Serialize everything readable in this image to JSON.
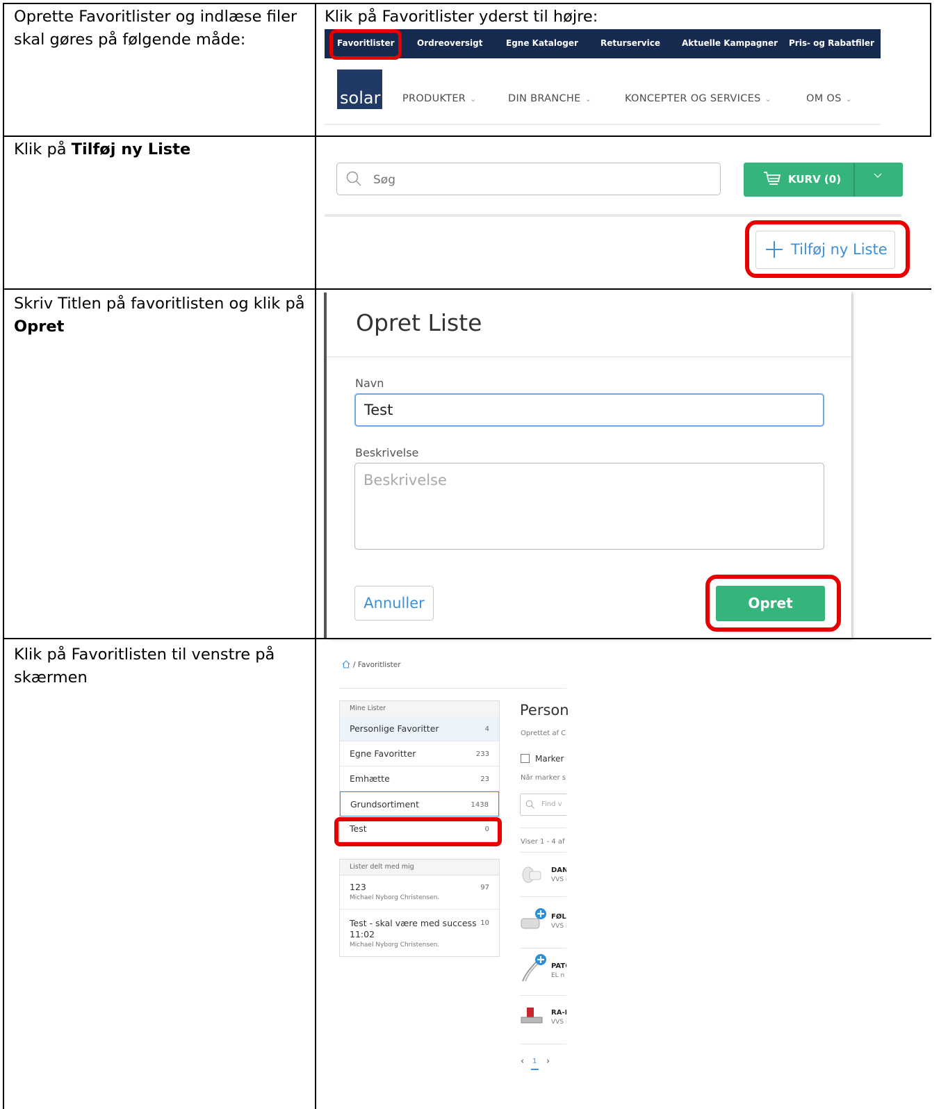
{
  "rows": [
    {
      "left_text": "Oprette Favoritlister og indlæse filer skal gøres på følgende måde:",
      "right_title": "Klik på Favoritlister yderst til højre:"
    },
    {
      "left_prefix": "Klik på ",
      "left_bold": "Tilføj ny Liste"
    },
    {
      "left_prefix": "Skriv Titlen på favoritlisten og klik på ",
      "left_bold": "Opret"
    },
    {
      "left_text": "Klik på Favoritlisten til venstre på skærmen"
    }
  ],
  "nav": {
    "items": [
      "Favoritlister",
      "Ordreoversigt",
      "Egne Kataloger",
      "Returservice",
      "Aktuelle Kampagner",
      "Pris- og Rabatfiler"
    ],
    "logo": "solar",
    "menu": [
      "PRODUKTER",
      "DIN BRANCHE",
      "KONCEPTER OG SERVICES",
      "OM OS"
    ]
  },
  "shop": {
    "search_placeholder": "Søg",
    "cart_label": "KURV (0)",
    "add_list_label": "Tilføj ny Liste"
  },
  "modal": {
    "title": "Opret Liste",
    "name_label": "Navn",
    "name_value": "Test",
    "desc_label": "Beskrivelse",
    "desc_placeholder": "Beskrivelse",
    "cancel": "Annuller",
    "create": "Opret"
  },
  "favorites": {
    "breadcrumb": "/ Favoritlister",
    "my_lists_header": "Mine Lister",
    "my_lists": [
      {
        "name": "Personlige Favoritter",
        "count": "4"
      },
      {
        "name": "Egne Favoritter",
        "count": "233"
      },
      {
        "name": "Emhætte",
        "count": "23"
      },
      {
        "name": "Grundsortiment",
        "count": "1438"
      },
      {
        "name": "Test",
        "count": "0"
      }
    ],
    "shared_header": "Lister delt med mig",
    "shared": [
      {
        "name": "123",
        "count": "97",
        "owner": "Michael Nyborg Christensen."
      },
      {
        "name": "Test - skal være med success",
        "name2": "11:02",
        "count": "10",
        "owner": "Michael Nyborg Christensen."
      }
    ],
    "page_title": "Person",
    "created_by": "Oprettet af C",
    "mark_label": "Marker",
    "mark_note": "Når marker s",
    "find_placeholder": "Find v",
    "showing": "Viser 1 - 4 af",
    "products": [
      {
        "name": "DAN",
        "cat": "VVS i"
      },
      {
        "name": "FØLI",
        "cat": "VVS i"
      },
      {
        "name": "PATC",
        "cat": "EL n"
      },
      {
        "name": "RA-N",
        "cat": "VVS i"
      }
    ],
    "pager_prev": "‹",
    "pager_page": "1",
    "pager_next": "›"
  },
  "colors": {
    "highlight": "#e80000",
    "nav_bg": "#152a4e",
    "green": "#35b47b",
    "link_blue": "#3d8fd6"
  }
}
